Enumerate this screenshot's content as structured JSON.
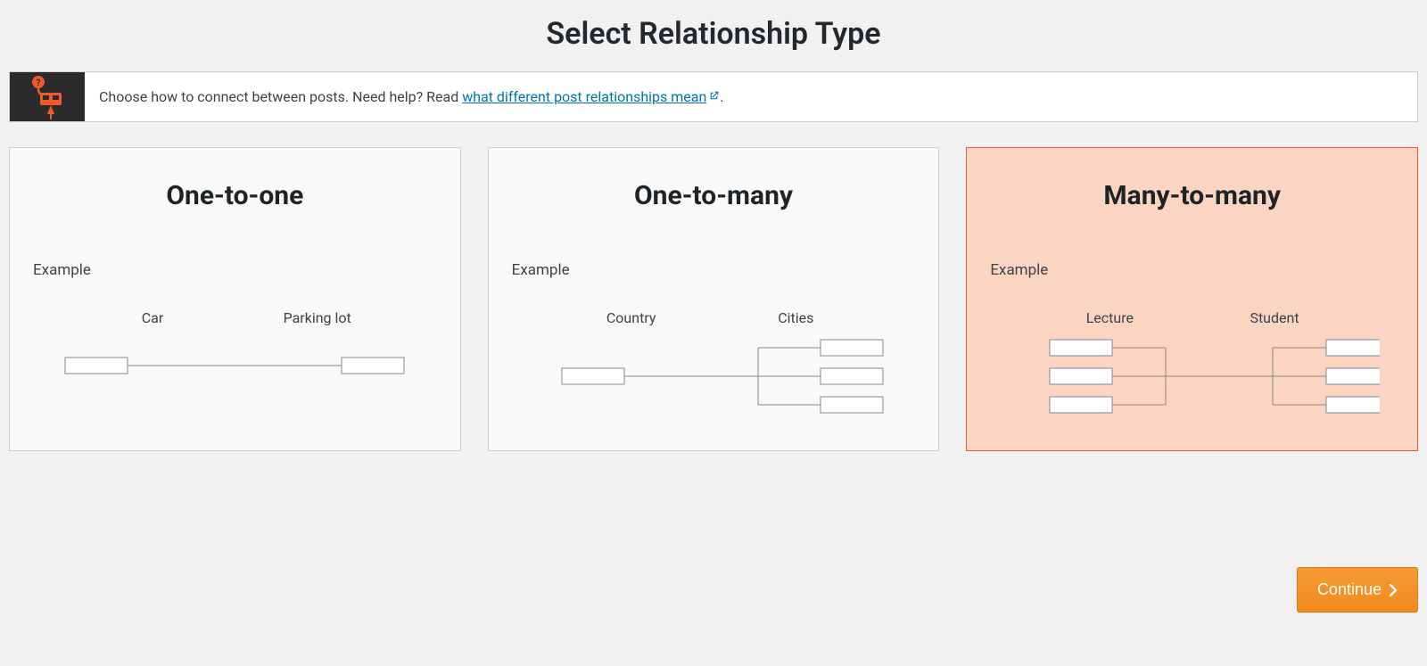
{
  "page": {
    "title": "Select Relationship Type"
  },
  "info": {
    "text_before_link": "Choose how to connect between posts. Need help? Read ",
    "link_text": "what different post relationships mean",
    "text_after_link": "."
  },
  "cards": {
    "one_to_one": {
      "title": "One-to-one",
      "example_label": "Example",
      "left_label": "Car",
      "right_label": "Parking lot",
      "selected": false
    },
    "one_to_many": {
      "title": "One-to-many",
      "example_label": "Example",
      "left_label": "Country",
      "right_label": "Cities",
      "selected": false
    },
    "many_to_many": {
      "title": "Many-to-many",
      "example_label": "Example",
      "left_label": "Lecture",
      "right_label": "Student",
      "selected": true
    }
  },
  "actions": {
    "continue_label": "Continue"
  },
  "colors": {
    "accent": "#f05a28",
    "button": "#f28a1e",
    "link": "#0073aa"
  }
}
